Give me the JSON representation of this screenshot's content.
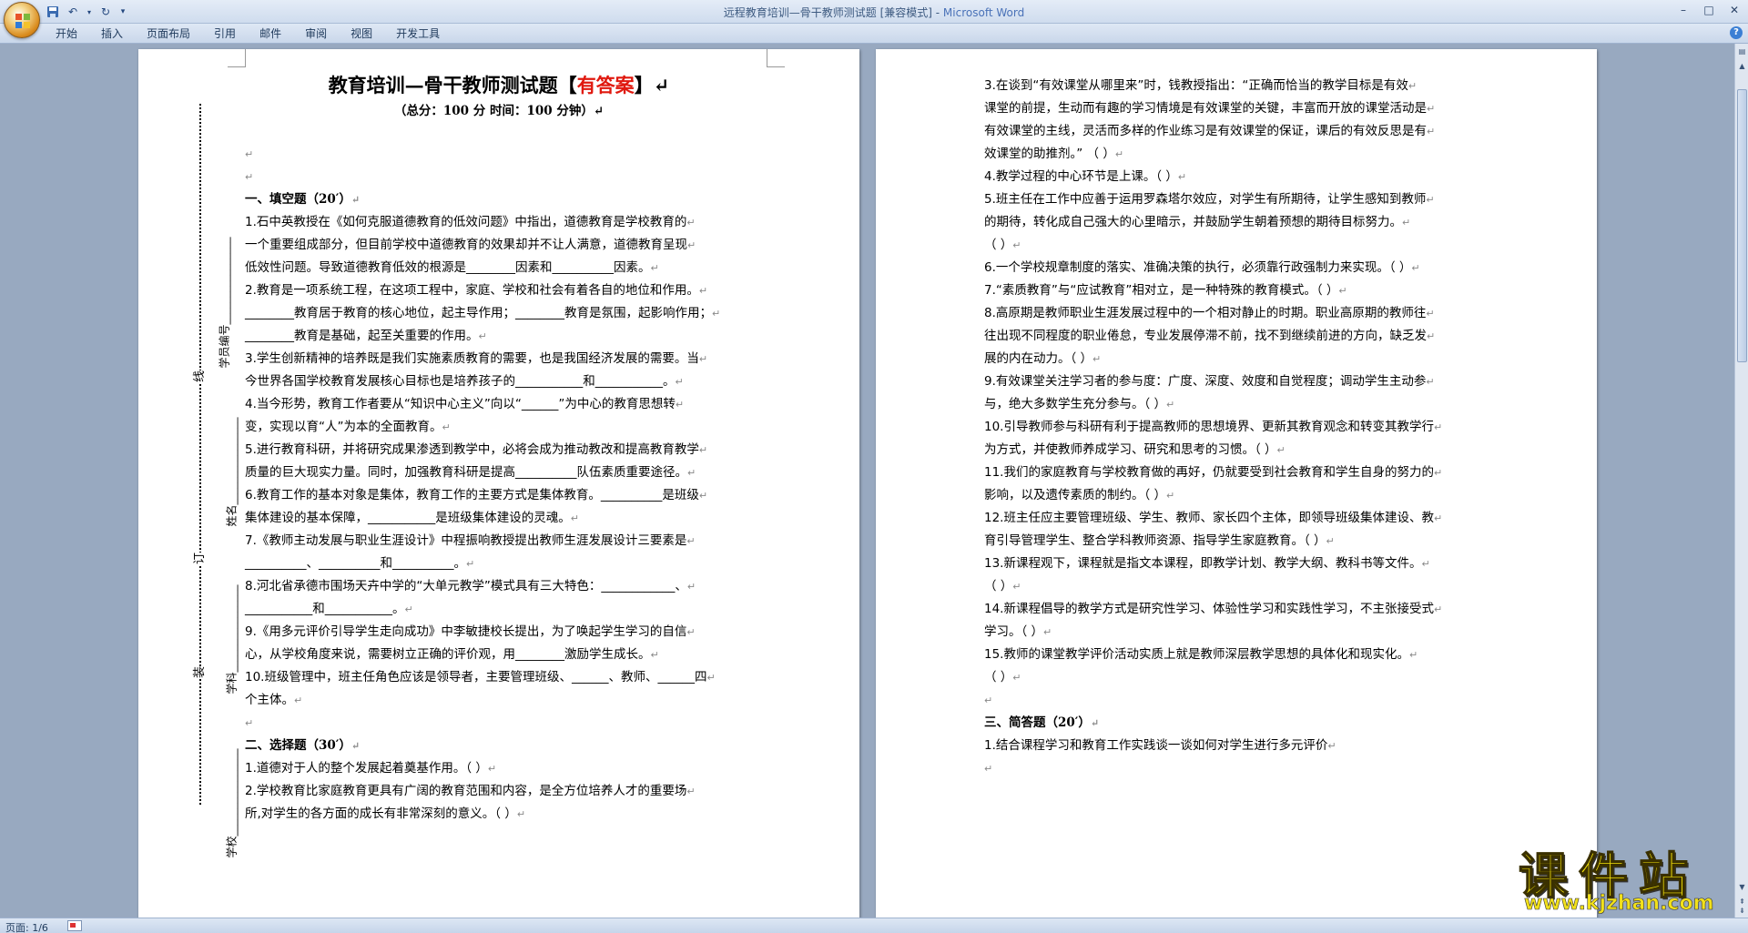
{
  "window": {
    "title": "远程教育培训—骨干教师测试题 [兼容模式] - ",
    "app_name": "Microsoft Word"
  },
  "ribbon": {
    "tabs": [
      "开始",
      "插入",
      "页面布局",
      "引用",
      "邮件",
      "审阅",
      "视图",
      "开发工具"
    ]
  },
  "document": {
    "title_main": "教育培训—骨干教师测试题【",
    "title_answer": "有答案",
    "title_end": "】",
    "subtitle": "（总分：100 分      时间：100 分钟）",
    "binding": {
      "labels": [
        "学员编号",
        "姓名",
        "学科",
        "学校"
      ],
      "line_chars": [
        "线",
        "订",
        "装"
      ]
    },
    "left_paragraphs": [
      {
        "text": "",
        "sec": false
      },
      {
        "text": "",
        "sec": false
      },
      {
        "text": "一、填空题（20′）",
        "sec": true
      },
      {
        "text": "1.石中英教授在《如何克服道德教育的低效问题》中指出，道德教育是学校教育的",
        "sec": false
      },
      {
        "text": "一个重要组成部分，但目前学校中道德教育的效果却并不让人满意，道德教育呈现",
        "sec": false
      },
      {
        "text": "低效性问题。导致道德教育低效的根源是________因素和__________因素。",
        "sec": false
      },
      {
        "text": "2.教育是一项系统工程，在这项工程中，家庭、学校和社会有着各自的地位和作用。",
        "sec": false
      },
      {
        "text": "________教育居于教育的核心地位，起主导作用；________教育是氛围，起影响作用；",
        "sec": false
      },
      {
        "text": "________教育是基础，起至关重要的作用。",
        "sec": false
      },
      {
        "text": "3.学生创新精神的培养既是我们实施素质教育的需要，也是我国经济发展的需要。当",
        "sec": false
      },
      {
        "text": "今世界各国学校教育发展核心目标也是培养孩子的___________和___________。",
        "sec": false
      },
      {
        "text": "4.当今形势，教育工作者要从“知识中心主义”向以“______”为中心的教育思想转",
        "sec": false
      },
      {
        "text": "变，实现以育“人”为本的全面教育。",
        "sec": false
      },
      {
        "text": "5.进行教育科研，并将研究成果渗透到教学中，必将会成为推动教改和提高教育教学",
        "sec": false
      },
      {
        "text": "质量的巨大现实力量。同时，加强教育科研是提高__________队伍素质重要途径。",
        "sec": false
      },
      {
        "text": "6.教育工作的基本对象是集体，教育工作的主要方式是集体教育。__________是班级",
        "sec": false
      },
      {
        "text": "集体建设的基本保障，___________是班级集体建设的灵魂。",
        "sec": false
      },
      {
        "text": "7.《教师主动发展与职业生涯设计》中程振响教授提出教师生涯发展设计三要素是",
        "sec": false
      },
      {
        "text": "__________、__________和__________。",
        "sec": false
      },
      {
        "text": "8.河北省承德市围场天卉中学的“大单元教学”模式具有三大特色：____________、",
        "sec": false
      },
      {
        "text": "___________和___________。",
        "sec": false
      },
      {
        "text": "9.《用多元评价引导学生走向成功》中李敏捷校长提出，为了唤起学生学习的自信",
        "sec": false
      },
      {
        "text": "心，从学校角度来说，需要树立正确的评价观，用________激励学生成长。",
        "sec": false
      },
      {
        "text": "10.班级管理中，班主任角色应该是领导者，主要管理班级、______、教师、______四",
        "sec": false
      },
      {
        "text": "个主体。",
        "sec": false
      },
      {
        "text": "",
        "sec": false
      },
      {
        "text": "二、选择题（30′）",
        "sec": true
      },
      {
        "text": "1.道德对于人的整个发展起着奠基作用。（          ）",
        "sec": false
      },
      {
        "text": "2.学校教育比家庭教育更具有广阔的教育范围和内容，是全方位培养人才的重要场",
        "sec": false
      },
      {
        "text": "所,对学生的各方面的成长有非常深刻的意义。（          ）",
        "sec": false
      }
    ],
    "right_paragraphs": [
      {
        "text": "3.在谈到“有效课堂从哪里来”时，钱教授指出：“正确而恰当的教学目标是有效",
        "sec": false
      },
      {
        "text": "课堂的前提，生动而有趣的学习情境是有效课堂的关键，丰富而开放的课堂活动是",
        "sec": false
      },
      {
        "text": "有效课堂的主线，灵活而多样的作业练习是有效课堂的保证，课后的有效反思是有",
        "sec": false
      },
      {
        "text": "效课堂的助推剂。”  （          ）",
        "sec": false
      },
      {
        "text": "4.教学过程的中心环节是上课。（          ）",
        "sec": false
      },
      {
        "text": "5.班主任在工作中应善于运用罗森塔尔效应，对学生有所期待，让学生感知到教师",
        "sec": false
      },
      {
        "text": "的期待，转化成自己强大的心里暗示，并鼓励学生朝着预想的期待目标努力。",
        "sec": false
      },
      {
        "text": "（          ）",
        "sec": false
      },
      {
        "text": "6.一个学校规章制度的落实、准确决策的执行，必须靠行政强制力来实现。（          ）",
        "sec": false
      },
      {
        "text": "7.“素质教育”与“应试教育”相对立，是一种特殊的教育模式。（          ）",
        "sec": false
      },
      {
        "text": "8.高原期是教师职业生涯发展过程中的一个相对静止的时期。职业高原期的教师往",
        "sec": false
      },
      {
        "text": "往出现不同程度的职业倦怠，专业发展停滞不前，找不到继续前进的方向，缺乏发",
        "sec": false
      },
      {
        "text": "展的内在动力。（          ）",
        "sec": false
      },
      {
        "text": "9.有效课堂关注学习者的参与度：广度、深度、效度和自觉程度；调动学生主动参",
        "sec": false
      },
      {
        "text": "与，绝大多数学生充分参与。（          ）",
        "sec": false
      },
      {
        "text": "10.引导教师参与科研有利于提高教师的思想境界、更新其教育观念和转变其教学行",
        "sec": false
      },
      {
        "text": "为方式，并使教师养成学习、研究和思考的习惯。（          ）",
        "sec": false
      },
      {
        "text": "11.我们的家庭教育与学校教育做的再好，仍就要受到社会教育和学生自身的努力的",
        "sec": false
      },
      {
        "text": "影响，以及遗传素质的制约。（          ）",
        "sec": false
      },
      {
        "text": "12.班主任应主要管理班级、学生、教师、家长四个主体，即领导班级集体建设、教",
        "sec": false
      },
      {
        "text": "育引导管理学生、整合学科教师资源、指导学生家庭教育。（          ）",
        "sec": false
      },
      {
        "text": "13.新课程观下，课程就是指文本课程，即教学计划、教学大纲、教科书等文件。",
        "sec": false
      },
      {
        "text": "（          ）",
        "sec": false
      },
      {
        "text": "14.新课程倡导的教学方式是研究性学习、体验性学习和实践性学习，不主张接受式",
        "sec": false
      },
      {
        "text": "学习。（          ）",
        "sec": false
      },
      {
        "text": "15.教师的课堂教学评价活动实质上就是教师深层教学思想的具体化和现实化。",
        "sec": false
      },
      {
        "text": "（          ）",
        "sec": false
      },
      {
        "text": "",
        "sec": false
      },
      {
        "text": "三、简答题（20′）",
        "sec": true
      },
      {
        "text": "1.结合课程学习和教育工作实践谈一谈如何对学生进行多元评价",
        "sec": false
      },
      {
        "text": "",
        "sec": false
      }
    ]
  },
  "status": {
    "page_info": "页面: 1/6"
  },
  "watermark": {
    "main": "课件站",
    "url": "www.kjzhan.com"
  },
  "colors": {
    "answer": "#e0190f",
    "background": "#98a9c0",
    "ribbon": "#dfe8f5"
  }
}
